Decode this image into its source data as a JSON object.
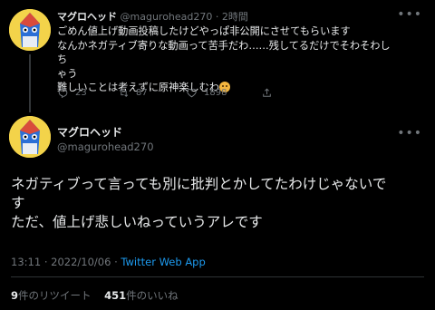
{
  "reply_tweet": {
    "display_name": "マグロヘッド",
    "handle": "@magurohead270",
    "separator": "·",
    "time_ago": "2時間",
    "lines": [
      "ごめん値上げ動画投稿したけどやっぱ非公開にさせてもらいます",
      "なんかネガティブ寄りな動画って苦手だわ……残してるだけでそわそわしち",
      "ゃう",
      "難しいことは考えずに原神楽しむわ"
    ],
    "emoji": "grinning-sweat-emoji",
    "actions": {
      "reply_count": "23",
      "retweet_count": "87",
      "like_count": "1898"
    }
  },
  "main_tweet": {
    "display_name": "マグロヘッド",
    "handle": "@magurohead270",
    "lines": [
      "ネガティブって言っても別に批判とかしてたわけじゃないで",
      "す",
      "ただ、値上げ悲しいねっていうアレです"
    ],
    "time": "13:11",
    "dot": "·",
    "date": "2022/10/06",
    "source": "Twitter Web App",
    "retweets_count": "9",
    "retweets_label": "件のリツイート",
    "likes_count": "451",
    "likes_label": "件のいいね"
  },
  "icons": {
    "more": "more-horizontal-icon",
    "reply": "reply-icon",
    "retweet": "retweet-icon",
    "like": "heart-icon",
    "share": "share-icon"
  },
  "colors": {
    "background": "#000000",
    "text": "#e7e9ea",
    "muted": "#71767b",
    "link": "#1d9bf0",
    "divider": "#2f3336"
  }
}
